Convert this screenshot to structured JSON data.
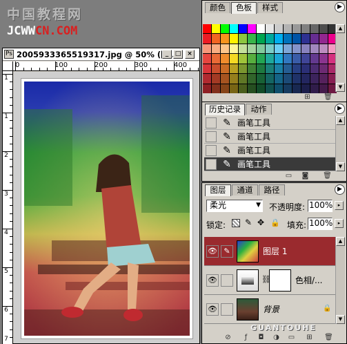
{
  "watermark": {
    "line1": "中国教程网",
    "line2_a": "JCWW",
    "line2_b": "CN.COM"
  },
  "doc_window": {
    "title": "2005933365519317.jpg @ 50% (图...",
    "minimize": "_",
    "maximize": "□",
    "close": "×",
    "hruler": [
      "0",
      "100",
      "200",
      "300",
      "400"
    ],
    "vruler": [
      "1",
      "1",
      "2",
      "3",
      "4",
      "5",
      "6",
      "7"
    ]
  },
  "swatches": {
    "tabs": [
      "颜色",
      "色板",
      "样式"
    ],
    "active_tab": 1,
    "colors": [
      "#ff0000",
      "#ffff00",
      "#00ff00",
      "#00ffff",
      "#0000ff",
      "#ff00ff",
      "#ffffff",
      "#e6e6e6",
      "#cccccc",
      "#b3b3b3",
      "#999999",
      "#808080",
      "#666666",
      "#4d4d4d",
      "#333333",
      "#ed1c24",
      "#f26522",
      "#f7941d",
      "#fff200",
      "#8dc63f",
      "#39b54a",
      "#00a651",
      "#00a99d",
      "#00aeef",
      "#0072bc",
      "#0054a6",
      "#2e3192",
      "#662d91",
      "#92278f",
      "#ec008c",
      "#f7977a",
      "#f9ad81",
      "#fdc68a",
      "#fff79a",
      "#c4df9b",
      "#a3d39c",
      "#82ca9d",
      "#7bcdc8",
      "#6ecff6",
      "#7ea7d8",
      "#8493ca",
      "#8882be",
      "#a187be",
      "#bc8dbf",
      "#f49ac2",
      "#e6463f",
      "#e96a36",
      "#f08c2c",
      "#f5d923",
      "#9fc33a",
      "#57ae3f",
      "#23a553",
      "#1ea89c",
      "#1aa5d6",
      "#3278c0",
      "#3a5ca8",
      "#404597",
      "#63398f",
      "#8b348e",
      "#d5317f",
      "#d8353a",
      "#c94d2c",
      "#c96b25",
      "#b8a022",
      "#7a962f",
      "#3f8035",
      "#1e7940",
      "#1a7f78",
      "#1a7ea4",
      "#255d93",
      "#273f82",
      "#2b2f76",
      "#4c2c72",
      "#6d2a72",
      "#a92967",
      "#b12a30",
      "#a33a24",
      "#a65420",
      "#957f1d",
      "#5f7726",
      "#31652b",
      "#186135",
      "#146562",
      "#146487",
      "#1c4a77",
      "#1f3269",
      "#23265f",
      "#3c235c",
      "#56215c",
      "#881f52",
      "#8f1f24",
      "#82301c",
      "#864418",
      "#786515",
      "#4a5e1d",
      "#264f21",
      "#124c29",
      "#10514e",
      "#0f4f6c",
      "#163b60",
      "#182851",
      "#1c1e4b",
      "#301c4a",
      "#441a4a",
      "#6e1942"
    ],
    "footer_new": "⊞",
    "footer_delete": "🗑"
  },
  "history": {
    "tabs": [
      "历史记录",
      "动作"
    ],
    "active_tab": 0,
    "items": [
      "画笔工具",
      "画笔工具",
      "画笔工具",
      "画笔工具"
    ],
    "selected_index": 3
  },
  "layers": {
    "tabs": [
      "图层",
      "通道",
      "路径"
    ],
    "active_tab": 0,
    "blend_mode": "柔光",
    "opacity_label": "不透明度:",
    "opacity_value": "100%",
    "lock_label": "锁定:",
    "fill_label": "填充:",
    "fill_value": "100%",
    "items": [
      {
        "name": "图层 1",
        "selected": true
      },
      {
        "name": "色相/...",
        "selected": false
      },
      {
        "name": "背景",
        "selected": false,
        "locked": true
      }
    ],
    "watermark": "GUANTOUHE"
  },
  "colors": {
    "selected_layer": "#9a2a2e",
    "history_selected": "#3a3a3a"
  }
}
